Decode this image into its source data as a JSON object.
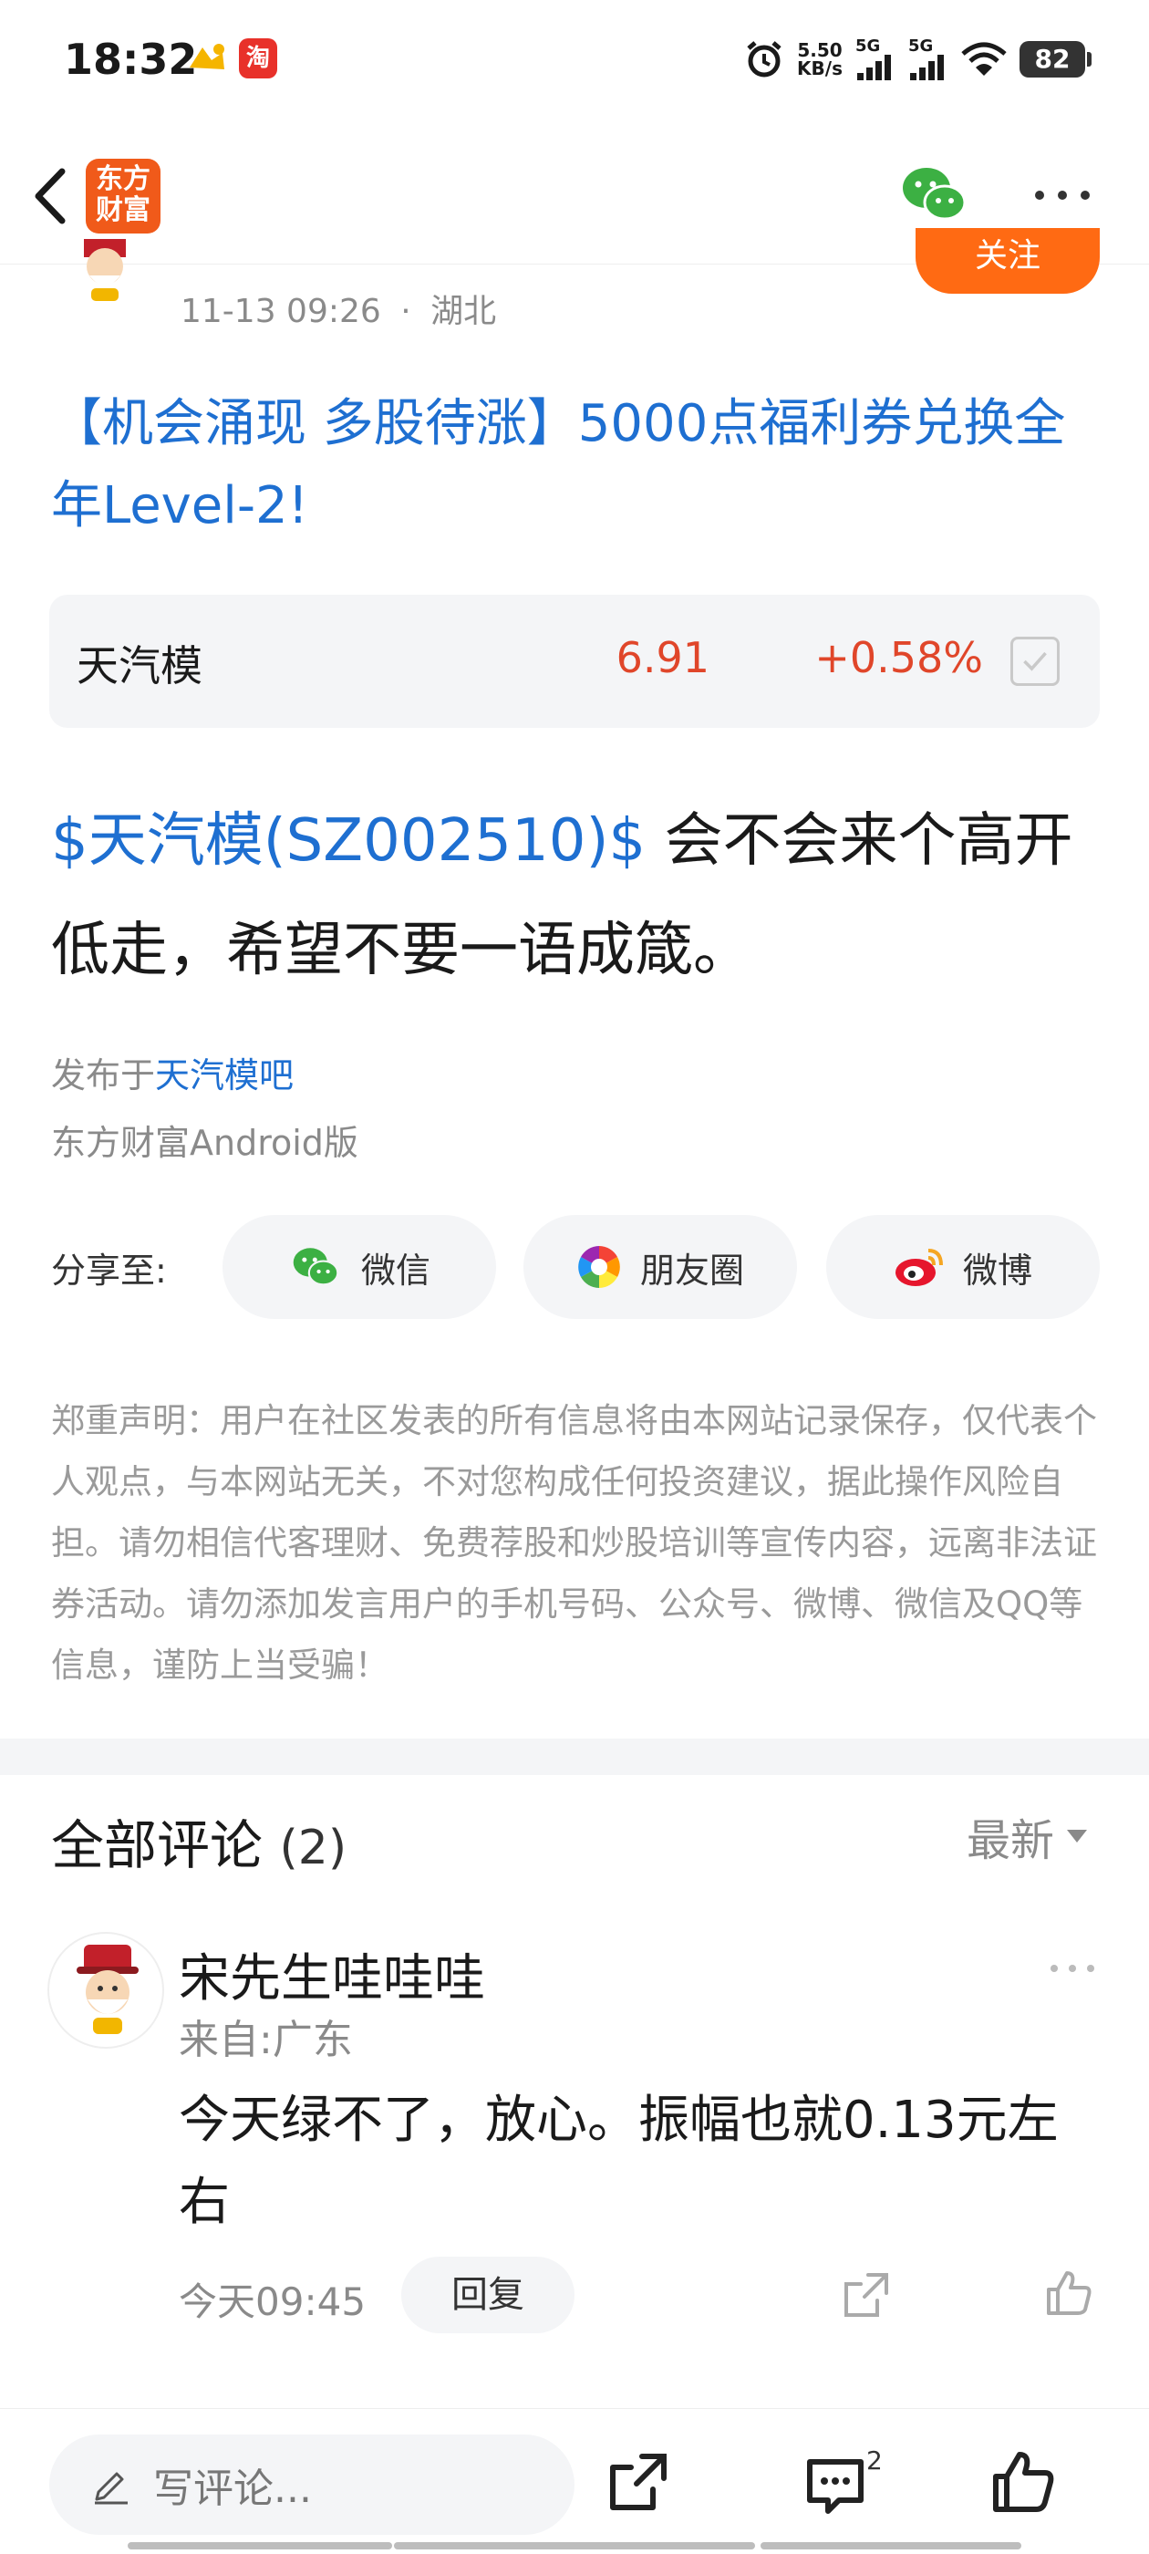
{
  "status_bar": {
    "time": "18:32",
    "speed_value": "5.50",
    "speed_unit": "KB/s",
    "net1": "5G",
    "net2": "5G",
    "battery": "82",
    "app2_glyph": "淘"
  },
  "header": {
    "logo_line1": "东方",
    "logo_line2": "财富",
    "icons": [
      "back-icon",
      "wechat-icon",
      "more-icon"
    ]
  },
  "post": {
    "follow_label": "关注",
    "meta_time": "11-13 09:26",
    "meta_sep": "·",
    "meta_location": "湖北",
    "title": "【机会涌现 多股待涨】5000点福利券兑换全年Level-2!",
    "stock": {
      "name": "天汽模",
      "price": "6.91",
      "change": "+0.58%",
      "price_color": "#e0462a"
    },
    "body_tag": "$天汽模(SZ002510)$",
    "body_text": " 会不会来个高开低走，希望不要一语成箴。",
    "publish_prefix": "发布于",
    "publish_bar": "天汽模吧",
    "client": "东方财富Android版"
  },
  "share": {
    "label": "分享至:",
    "wechat": "微信",
    "moments": "朋友圈",
    "weibo": "微博"
  },
  "disclaimer": "郑重声明：用户在社区发表的所有信息将由本网站记录保存，仅代表个人观点，与本网站无关，不对您构成任何投资建议，据此操作风险自担。请勿相信代客理财、免费荐股和炒股培训等宣传内容，远离非法证券活动。请勿添加发言用户的手机号码、公众号、微博、微信及QQ等信息，谨防上当受骗！",
  "comments": {
    "title": "全部评论",
    "count": "(2)",
    "sort": "最新",
    "items": [
      {
        "user": "宋先生哇哇哇",
        "from": "来自:广东",
        "text": "今天绿不了，放心。振幅也就0.13元左右",
        "time": "今天09:45",
        "reply_label": "回复"
      }
    ]
  },
  "bottom_bar": {
    "compose_placeholder": "写评论...",
    "comment_badge": "2"
  },
  "colors": {
    "accent_blue": "#1e6fd1",
    "accent_orange": "#ff6a13",
    "up_red": "#e0462a"
  }
}
